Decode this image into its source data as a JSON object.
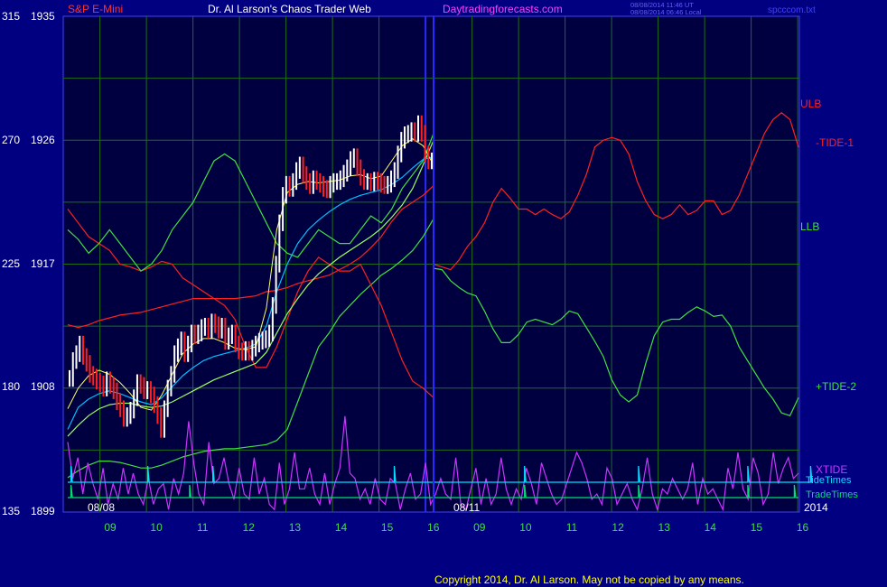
{
  "header": {
    "instrument": "S&P E-Mini",
    "title": "Dr. Al Larson's Chaos Trader Web",
    "site": "Daytradingforecasts.com",
    "time_utc": "08/08/2014 11:46 UT",
    "time_local": "08/08/2014 06:46 Local",
    "file": "spcccom.txt"
  },
  "colors": {
    "background": "#000080",
    "plot_bg": "#000040",
    "grid": "#1e6e1e",
    "divider": "#2a2aff",
    "ulb": "#ff2020",
    "llb": "#40e040",
    "xtide": "#cc33ff",
    "tidetimes": "#00e0ff",
    "tradetimes": "#00e070",
    "price": "#ffffff",
    "down": "#ff2020",
    "ma_fast": "#ffff60",
    "ma_slow": "#00c0ff",
    "ma_green": "#9cff60"
  },
  "chart_data": {
    "type": "line",
    "title": "S&P E-Mini",
    "left_axis_labels": [
      "315",
      "270",
      "225",
      "180",
      "135"
    ],
    "right_axis_labels": [
      "1935",
      "1926",
      "1917",
      "1908",
      "1899"
    ],
    "ylim": [
      1899,
      1935
    ],
    "x_hour_labels": [
      "09",
      "10",
      "11",
      "12",
      "13",
      "14",
      "15",
      "16",
      "09",
      "10",
      "11",
      "12",
      "13",
      "14",
      "15",
      "16"
    ],
    "date_labels": [
      "08/08",
      "08/11",
      "2014"
    ],
    "legend": [
      {
        "name": "ULB",
        "color": "#ff2020"
      },
      {
        "name": "-TIDE-1",
        "color": "#ff2020"
      },
      {
        "name": "LLB",
        "color": "#40e040"
      },
      {
        "name": "+TIDE-2",
        "color": "#40e040"
      },
      {
        "name": "XTIDE",
        "color": "#cc33ff"
      },
      {
        "name": "TideTimes",
        "color": "#00e0ff"
      },
      {
        "name": "TradeTimes",
        "color": "#00e070"
      }
    ],
    "price_close": [
      1908.7,
      1910.0,
      1910.5,
      1911.2,
      1910.3,
      1909.8,
      1909.0,
      1908.8,
      1908.5,
      1908.3,
      1908.0,
      1908.6,
      1908.2,
      1907.8,
      1907.0,
      1906.5,
      1905.8,
      1906.0,
      1906.4,
      1907.3,
      1908.4,
      1908.2,
      1907.8,
      1907.9,
      1907.5,
      1906.8,
      1906.0,
      1905.0,
      1906.5,
      1908.0,
      1909.0,
      1910.5,
      1911.0,
      1911.5,
      1910.5,
      1911.2,
      1912.0,
      1911.8,
      1912.0,
      1912.4,
      1912.5,
      1912.2,
      1912.8,
      1912.6,
      1912.2,
      1912.5,
      1911.4,
      1911.8,
      1912.0,
      1911.2,
      1910.7,
      1910.6,
      1910.8,
      1910.6,
      1910.9,
      1911.2,
      1911.4,
      1911.5,
      1911.6,
      1912.0,
      1914.0,
      1917.0,
      1920.0,
      1922.0,
      1922.8,
      1922.5,
      1923.0,
      1923.8,
      1924.2,
      1923.5,
      1923.0,
      1922.7,
      1923.2,
      1923.0,
      1922.8,
      1922.5,
      1922.4,
      1922.8,
      1923.0,
      1923.0,
      1923.2,
      1923.6,
      1924.0,
      1924.6,
      1924.8,
      1924.0,
      1923.3,
      1923.0,
      1923.0,
      1922.9,
      1923.1,
      1923.0,
      1922.8,
      1922.7,
      1922.8,
      1923.2,
      1923.8,
      1925.0,
      1926.0,
      1926.4,
      1926.5,
      1926.7,
      1926.5,
      1927.2,
      1926.5,
      1925.0,
      1924.5,
      1924.5
    ],
    "x_price_range": [
      0,
      8
    ],
    "ma_fast": [
      1906.5,
      1908.0,
      1908.9,
      1909.3,
      1909.0,
      1908.4,
      1907.6,
      1906.6,
      1906.4,
      1907.5,
      1909.0,
      1910.5,
      1911.2,
      1911.6,
      1911.6,
      1911.3,
      1910.9,
      1910.8,
      1911.0,
      1913.8,
      1919.5,
      1922.2,
      1922.8,
      1923.0,
      1922.9,
      1923.0,
      1923.1,
      1923.4,
      1923.5,
      1923.2,
      1923.4,
      1924.5,
      1925.6,
      1926.1,
      1925.6,
      1924.2
    ],
    "ma_slow": [
      1905.0,
      1906.6,
      1907.2,
      1907.6,
      1907.8,
      1907.6,
      1907.3,
      1907.0,
      1906.8,
      1907.3,
      1908.1,
      1908.9,
      1909.5,
      1910.0,
      1910.3,
      1910.5,
      1910.7,
      1910.9,
      1911.2,
      1912.5,
      1915.0,
      1917.0,
      1918.5,
      1919.5,
      1920.2,
      1920.8,
      1921.3,
      1921.7,
      1922.0,
      1922.2,
      1922.4,
      1922.8,
      1923.3,
      1924.0,
      1924.6,
      1924.8
    ],
    "ma_green": [
      1904.5,
      1905.3,
      1906.0,
      1906.5,
      1906.8,
      1906.9,
      1906.9,
      1906.7,
      1906.6,
      1906.7,
      1907.0,
      1907.4,
      1907.8,
      1908.2,
      1908.6,
      1908.9,
      1909.2,
      1909.5,
      1909.8,
      1910.6,
      1912.0,
      1913.4,
      1914.5,
      1915.5,
      1916.3,
      1916.9,
      1917.5,
      1918.0,
      1918.5,
      1919.0,
      1919.6,
      1920.4,
      1921.3,
      1922.5,
      1924.2,
      1926.0
    ],
    "ulb": [
      1912.6,
      1912.4,
      1912.6,
      1912.9,
      1913.1,
      1913.3,
      1913.4,
      1913.5,
      1913.7,
      1913.9,
      1914.1,
      1914.3,
      1914.5,
      1914.5,
      1914.5,
      1914.5,
      1914.5,
      1914.6,
      1914.7,
      1915.0,
      1915.1,
      1915.3,
      1915.6,
      1915.8,
      1916.0,
      1916.2,
      1916.6,
      1917.0,
      1917.5,
      1918.2,
      1919.0,
      1920.1,
      1921.0,
      1921.5,
      1922.0,
      1922.7
    ],
    "llb": [
      1901.5,
      1902.0,
      1902.4,
      1902.7,
      1902.7,
      1902.6,
      1902.4,
      1902.2,
      1902.2,
      1902.4,
      1902.7,
      1903.0,
      1903.2,
      1903.4,
      1903.5,
      1903.6,
      1903.6,
      1903.7,
      1903.8,
      1903.9,
      1904.2,
      1905.0,
      1907.0,
      1909.0,
      1911.0,
      1912.0,
      1913.2,
      1914.0,
      1914.8,
      1915.5,
      1916.2,
      1916.7,
      1917.3,
      1918.0,
      1919.0,
      1920.3
    ],
    "tide1": [
      1921.0,
      1920.0,
      1919.0,
      1918.5,
      1918.0,
      1917.0,
      1916.8,
      1916.5,
      1916.8,
      1917.2,
      1917.0,
      1916.0,
      1915.5,
      1915.0,
      1914.5,
      1914.0,
      1913.0,
      1911.0,
      1909.5,
      1909.5,
      1911.0,
      1913.0,
      1915.0,
      1916.5,
      1917.5,
      1917.0,
      1916.5,
      1916.5,
      1917.0,
      1915.5,
      1914.0,
      1912.0,
      1910.0,
      1908.5,
      1908.0,
      1907.3
    ],
    "tide2": [
      1919.5,
      1918.8,
      1917.8,
      1918.5,
      1919.5,
      1918.5,
      1917.5,
      1916.5,
      1917.0,
      1918.0,
      1919.5,
      1920.5,
      1921.5,
      1923.0,
      1924.5,
      1925.0,
      1924.5,
      1923.0,
      1921.5,
      1920.0,
      1918.5,
      1917.8,
      1917.5,
      1918.5,
      1919.5,
      1919.0,
      1918.5,
      1918.5,
      1919.5,
      1920.5,
      1920.0,
      1921.0,
      1922.5,
      1923.5,
      1924.5,
      1926.5
    ],
    "tide1_future": [
      1917.0,
      1916.8,
      1916.6,
      1917.3,
      1918.3,
      1919.0,
      1920.0,
      1921.5,
      1922.5,
      1921.8,
      1921.0,
      1921.0,
      1920.6,
      1921.0,
      1920.6,
      1920.3,
      1920.8,
      1922.0,
      1923.5,
      1925.5,
      1926.0,
      1926.2,
      1926.0,
      1925.0,
      1923.0,
      1921.6,
      1920.6,
      1920.3,
      1920.6,
      1921.3,
      1920.6,
      1920.9,
      1921.6,
      1921.6,
      1920.6,
      1920.9,
      1922.0,
      1923.5,
      1925.0,
      1926.5,
      1927.5,
      1928.0,
      1927.5,
      1925.5
    ],
    "tide2_future": [
      1916.7,
      1916.6,
      1915.8,
      1915.3,
      1914.9,
      1914.7,
      1913.6,
      1912.3,
      1911.3,
      1911.3,
      1911.9,
      1912.8,
      1913.0,
      1912.8,
      1912.6,
      1913.0,
      1913.6,
      1913.4,
      1912.4,
      1911.4,
      1910.3,
      1908.6,
      1907.5,
      1907.0,
      1907.5,
      1909.8,
      1911.8,
      1912.8,
      1913.0,
      1913.0,
      1913.5,
      1913.9,
      1913.6,
      1913.2,
      1913.3,
      1912.5,
      1911.0,
      1910.0,
      1909.0,
      1908.0,
      1907.2,
      1906.2,
      1906.0,
      1907.3
    ],
    "xtide": [
      0.7,
      0.35,
      0.55,
      0.2,
      0.5,
      0.3,
      0.15,
      0.45,
      0.1,
      0.3,
      0.15,
      0.45,
      0.2,
      0.4,
      0.2,
      0.1,
      0.35,
      0.1,
      0.25,
      0.3,
      0.05,
      0.35,
      0.2,
      0.4,
      0.9,
      0.5,
      0.2,
      0.1,
      0.7,
      0.3,
      0.35,
      0.55,
      0.3,
      0.15,
      0.45,
      0.2,
      0.15,
      0.55,
      0.2,
      0.35,
      0.1,
      0.05,
      0.5,
      0.1,
      0.25,
      0.6,
      0.25,
      0.25,
      0.45,
      0.2,
      0.1,
      0.4,
      0.1,
      0.3,
      0.45,
      0.95,
      0.4,
      0.35,
      0.15,
      0.25,
      0.1,
      0.35,
      0.15,
      0.1,
      0.35,
      0.3,
      0.05,
      0.25,
      0.4,
      0.15,
      0.2,
      0.5,
      0.1,
      0.2,
      0.35,
      0.2,
      0.15,
      0.55,
      0.1,
      0.05,
      0.25,
      0.45,
      0.1,
      0.35,
      0.1,
      0.2,
      0.55,
      0.25,
      0.1,
      0.25,
      0.15,
      0.45,
      0.3,
      0.1,
      0.5,
      0.35,
      0.2,
      0.1,
      0.15,
      0.3,
      0.45,
      0.6,
      0.5,
      0.35,
      0.15,
      0.2,
      0.1,
      0.45,
      0.35,
      0.1,
      0.2,
      0.3,
      0.15,
      0.05,
      0.25,
      0.55,
      0.2,
      0.05,
      0.25,
      0.2,
      0.35,
      0.25,
      0.15,
      0.25,
      0.5,
      0.1,
      0.35,
      0.2,
      0.25,
      0.15,
      0.05,
      0.45,
      0.25,
      0.6,
      0.25,
      0.15,
      0.55,
      0.4,
      0.1,
      0.2,
      0.6,
      0.3,
      0.45,
      0.55,
      0.35,
      0.4
    ],
    "tidetimes_days": [
      0.05,
      1.7,
      3.1,
      7.0,
      9.8,
      12.25,
      14.6,
      15.95
    ],
    "tradetimes_days": [
      0.05,
      2.6,
      9.8,
      12.25,
      14.6,
      15.6
    ]
  },
  "copyright": "Copyright 2014, Dr. Al Larson. May not be copied by any means."
}
